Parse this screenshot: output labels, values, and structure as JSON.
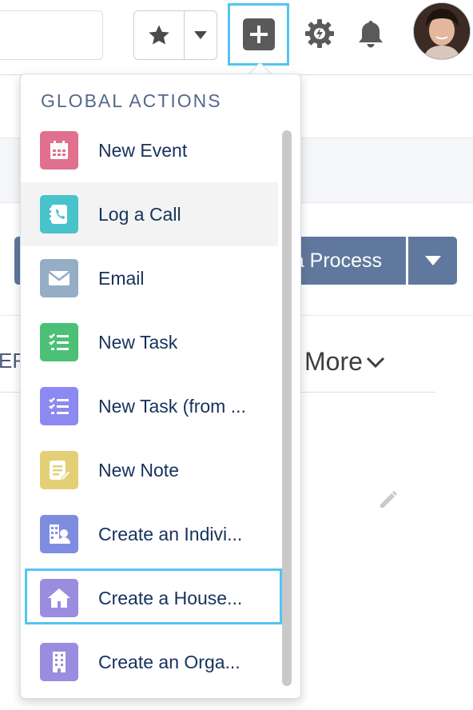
{
  "header": {
    "favorites_icon": "star-icon",
    "favorites_menu_icon": "chevron-down-icon",
    "global_actions_icon": "plus-icon",
    "setup_icon": "gear-icon",
    "notifications_icon": "bell-icon",
    "avatar_icon": "user-avatar"
  },
  "page": {
    "process_button_label": "a Process",
    "tab_fragment": "ER",
    "more_tab_label": "More"
  },
  "global_actions": {
    "title": "GLOBAL ACTIONS",
    "items": [
      {
        "label": "New Event",
        "icon": "calendar-icon",
        "color": "#e0708e"
      },
      {
        "label": "Log a Call",
        "icon": "phone-icon",
        "color": "#48c3cc"
      },
      {
        "label": "Email",
        "icon": "envelope-icon",
        "color": "#95aec5"
      },
      {
        "label": "New Task",
        "icon": "task-list-icon",
        "color": "#4bc076"
      },
      {
        "label": "New Task (from ...",
        "icon": "task-list-icon",
        "color": "#8c89f2"
      },
      {
        "label": "New Note",
        "icon": "note-icon",
        "color": "#e3d076"
      },
      {
        "label": "Create an Indivi...",
        "icon": "person-building-icon",
        "color": "#7f8de1"
      },
      {
        "label": "Create a House...",
        "icon": "house-icon",
        "color": "#9a8ce0"
      },
      {
        "label": "Create an Orga...",
        "icon": "building-icon",
        "color": "#9a8ce0"
      }
    ]
  },
  "colors": {
    "accent_outline": "#52c5f0",
    "brand_button": "#61789e"
  }
}
